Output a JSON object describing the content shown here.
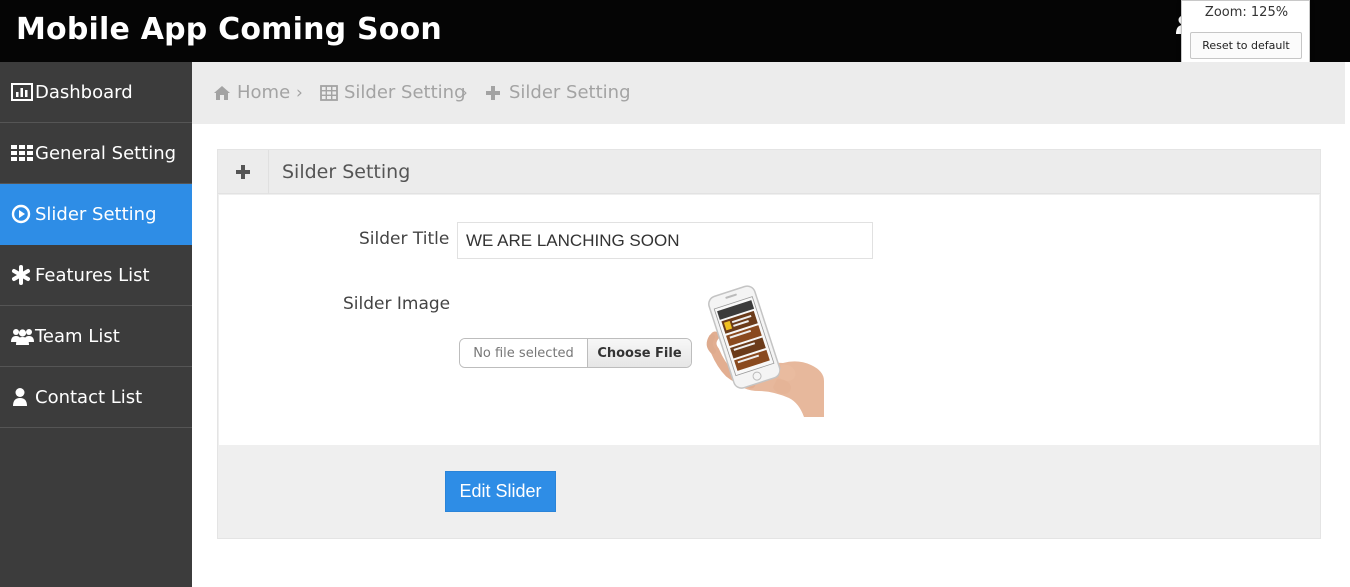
{
  "header": {
    "brand": "Mobile App Coming Soon",
    "user_icon": "user-icon"
  },
  "zoom_popup": {
    "label": "Zoom: 125%",
    "reset_label": "Reset to default"
  },
  "sidebar": {
    "items": [
      {
        "label": "Dashboard",
        "icon": "bar-chart-icon"
      },
      {
        "label": "General Setting",
        "icon": "grid-icon"
      },
      {
        "label": "Slider Setting",
        "icon": "play-circle-icon",
        "active": true
      },
      {
        "label": "Features List",
        "icon": "asterisk-icon"
      },
      {
        "label": "Team List",
        "icon": "users-icon"
      },
      {
        "label": "Contact List",
        "icon": "user-icon"
      }
    ]
  },
  "breadcrumb": {
    "items": [
      {
        "label": "Home",
        "icon": "home-icon"
      },
      {
        "label": "Silder Setting",
        "icon": "table-icon"
      },
      {
        "label": "Silder Setting",
        "icon": "plus-icon"
      }
    ],
    "separator": "›"
  },
  "panel": {
    "title": "Silder Setting",
    "icon": "plus-icon",
    "form": {
      "title_label": "Silder Title",
      "title_value": "WE ARE LANCHING SOON",
      "image_label": "Silder Image",
      "file_status": "No file selected",
      "file_button": "Choose File"
    },
    "submit_label": "Edit Slider"
  },
  "colors": {
    "topbar": "#050505",
    "sidebar": "#3c3c3c",
    "accent": "#2e8de6",
    "breadcrumb_bg": "#ececec"
  }
}
